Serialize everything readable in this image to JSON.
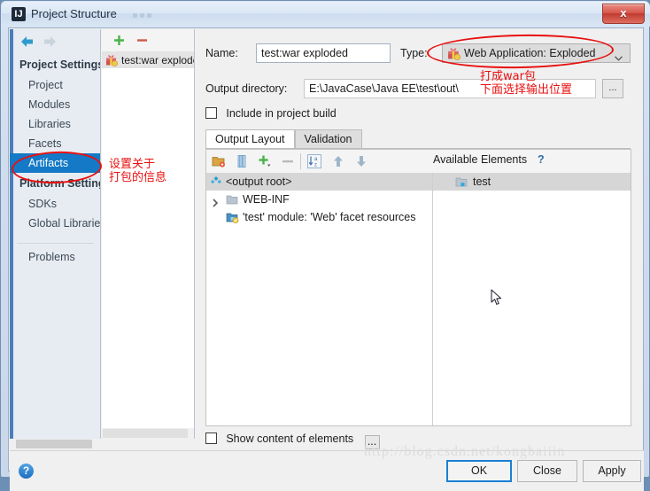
{
  "window": {
    "title": "Project Structure",
    "icon": "idea-logo-icon",
    "close_label": "x"
  },
  "nav": {
    "back_icon": "arrow-left-icon",
    "forward_icon": "arrow-right-icon",
    "groups": [
      {
        "label": "Project Settings",
        "items": [
          "Project",
          "Modules",
          "Libraries",
          "Facets",
          "Artifacts"
        ]
      },
      {
        "label": "Platform Settings",
        "items": [
          "SDKs",
          "Global Libraries"
        ]
      }
    ],
    "selected": "Artifacts",
    "footer_item": "Problems"
  },
  "artifacts_panel": {
    "add_icon": "plus-icon",
    "remove_icon": "minus-icon",
    "items": [
      {
        "label": "test:war exploded",
        "icon": "artifact-gift-icon",
        "selected": true
      }
    ]
  },
  "form": {
    "name_label": "Name:",
    "name_value": "test:war exploded",
    "type_label": "Type:",
    "type_value": "Web Application: Exploded",
    "type_icon": "artifact-gift-icon",
    "type_arrow_icon": "chevron-down-icon",
    "output_dir_label": "Output directory:",
    "output_dir_value": "E:\\JavaCase\\Java EE\\test\\out\\",
    "browse_label": "...",
    "include_build_label": "Include in project build",
    "include_build_checked": false
  },
  "tabs": [
    {
      "label": "Output Layout",
      "active": true
    },
    {
      "label": "Validation",
      "active": false
    }
  ],
  "layout_toolbar": {
    "icons": [
      "folder-settings-icon",
      "archive-icon",
      "plus-dropdown-icon",
      "minus-icon",
      "sort-alphabetical-icon",
      "move-up-icon",
      "move-down-icon"
    ]
  },
  "output_tree": {
    "nodes": [
      {
        "label": "<output root>",
        "icon": "output-root-icon",
        "indent": 0,
        "selected": true,
        "twisty": "none"
      },
      {
        "label": "WEB-INF",
        "icon": "folder-icon",
        "indent": 0,
        "selected": false,
        "twisty": "collapsed"
      },
      {
        "label": "'test' module: 'Web' facet resources",
        "icon": "facet-resources-icon",
        "indent": 1,
        "selected": false,
        "twisty": "none"
      }
    ]
  },
  "available_elements": {
    "title": "Available Elements",
    "help_label": "?",
    "items": [
      {
        "label": "test",
        "icon": "module-folder-icon",
        "selected": true
      }
    ]
  },
  "bottom": {
    "show_content_label": "Show content of elements",
    "show_content_checked": false,
    "show_content_more": "...",
    "help_icon": "question-mark-icon",
    "buttons": [
      {
        "id": "ok",
        "label": "OK",
        "default": true
      },
      {
        "id": "close",
        "label": "Close",
        "default": false
      },
      {
        "id": "apply",
        "label": "Apply",
        "default": false
      }
    ]
  },
  "watermark": "http://blog.csdn.net/kongbaiiin",
  "annotations": [
    {
      "id": "note-artifacts",
      "text": "设置关于\n打包的信息"
    },
    {
      "id": "note-type",
      "text": "打成war包\n下面选择输出位置"
    }
  ],
  "colors": {
    "accent": "#1479c6",
    "annotation": "#e81010",
    "default_button_border": "#1a7fd4"
  }
}
